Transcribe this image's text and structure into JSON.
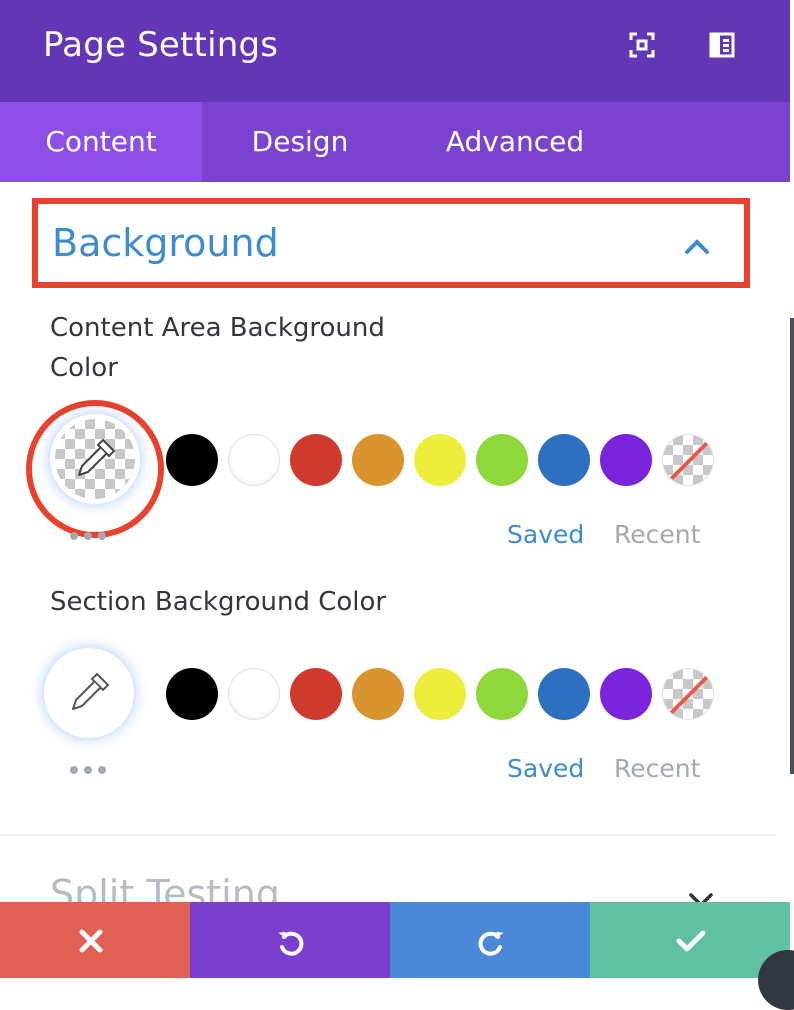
{
  "header": {
    "title": "Page Settings",
    "icons": [
      "expand-icon",
      "sidebar-icon"
    ],
    "color": "#6236b5"
  },
  "tabs": [
    {
      "label": "Content",
      "active": true
    },
    {
      "label": "Design",
      "active": false
    },
    {
      "label": "Advanced",
      "active": false
    }
  ],
  "toggle": {
    "label": "Background",
    "icon": "chevron-up-icon",
    "highlight_color": "#e8412c"
  },
  "fields": [
    {
      "label": "Content Area Background Color",
      "label_line1": "Content Area Background",
      "label_line2": "Color",
      "picker": "transparent",
      "swatches": [
        "#000000",
        "#ffffff",
        "#cf3a2c",
        "#d9942e",
        "#eded3c",
        "#8fd83b",
        "#2c70bf",
        "#7a25db",
        "transparent"
      ],
      "links": {
        "saved": "Saved",
        "recent": "Recent"
      }
    },
    {
      "label": "Section Background Color",
      "picker": "empty",
      "swatches": [
        "#000000",
        "#ffffff",
        "#cf3a2c",
        "#d9942e",
        "#eded3c",
        "#8fd83b",
        "#2c70bf",
        "#7a25db",
        "transparent"
      ],
      "links": {
        "saved": "Saved",
        "recent": "Recent"
      }
    }
  ],
  "collapsed_toggle": {
    "label": "Split Testing",
    "icon": "chevron-down-icon"
  },
  "footer": {
    "buttons": [
      {
        "name": "discard",
        "icon": "close-icon",
        "color": "#e06054"
      },
      {
        "name": "undo",
        "icon": "undo-icon",
        "color": "#7a3fcf"
      },
      {
        "name": "redo",
        "icon": "redo-icon",
        "color": "#4a89d8"
      },
      {
        "name": "save",
        "icon": "check-icon",
        "color": "#5fc0a3"
      }
    ]
  }
}
